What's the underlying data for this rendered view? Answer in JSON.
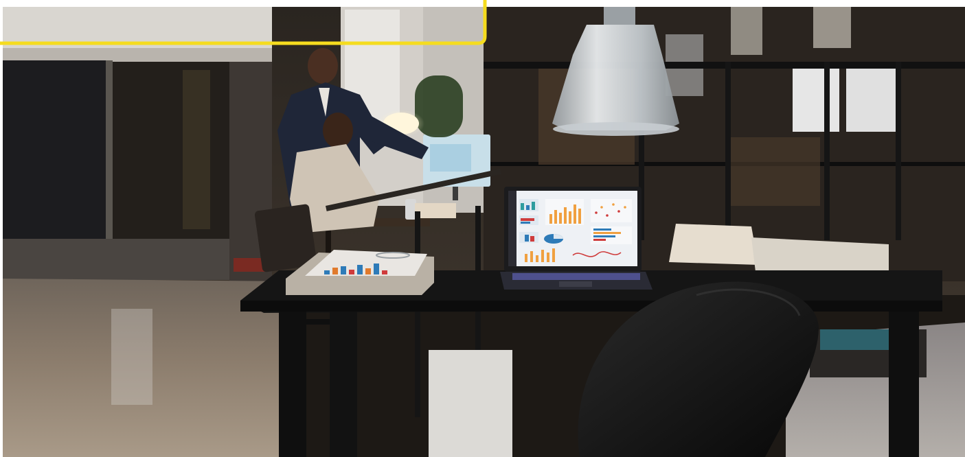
{
  "image": {
    "accent_outline_color": "#f5dc1f",
    "floor_color": "#8b7c6c",
    "desk_color": "#151515",
    "monitor_color": "#c8dfe9",
    "laptop_screen_color": "#eef1f5",
    "chair_color": "#111111",
    "lamp_color": "#d9dde0"
  }
}
